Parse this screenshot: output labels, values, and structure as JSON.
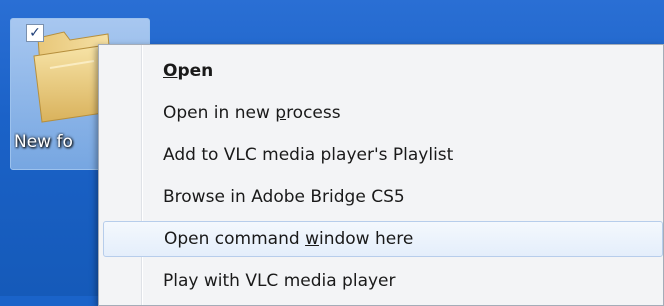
{
  "desktop": {
    "icon_label": "New fo",
    "checkbox_mark": "✓"
  },
  "context_menu": {
    "items": [
      {
        "pre": "",
        "ul": "O",
        "post": "pen"
      },
      {
        "pre": "Open in new ",
        "ul": "p",
        "post": "rocess"
      },
      {
        "pre": "Add to VLC media player's Playlist",
        "ul": "",
        "post": ""
      },
      {
        "pre": "Browse in Adobe Bridge CS5",
        "ul": "",
        "post": ""
      },
      {
        "pre": "Open command ",
        "ul": "w",
        "post": "indow here"
      },
      {
        "pre": "Play with VLC media player",
        "ul": "",
        "post": ""
      }
    ]
  },
  "colors": {
    "desktop_blue": "#1b62c8",
    "menu_background": "#f3f4f6",
    "hover_border": "#b7cdeb"
  }
}
